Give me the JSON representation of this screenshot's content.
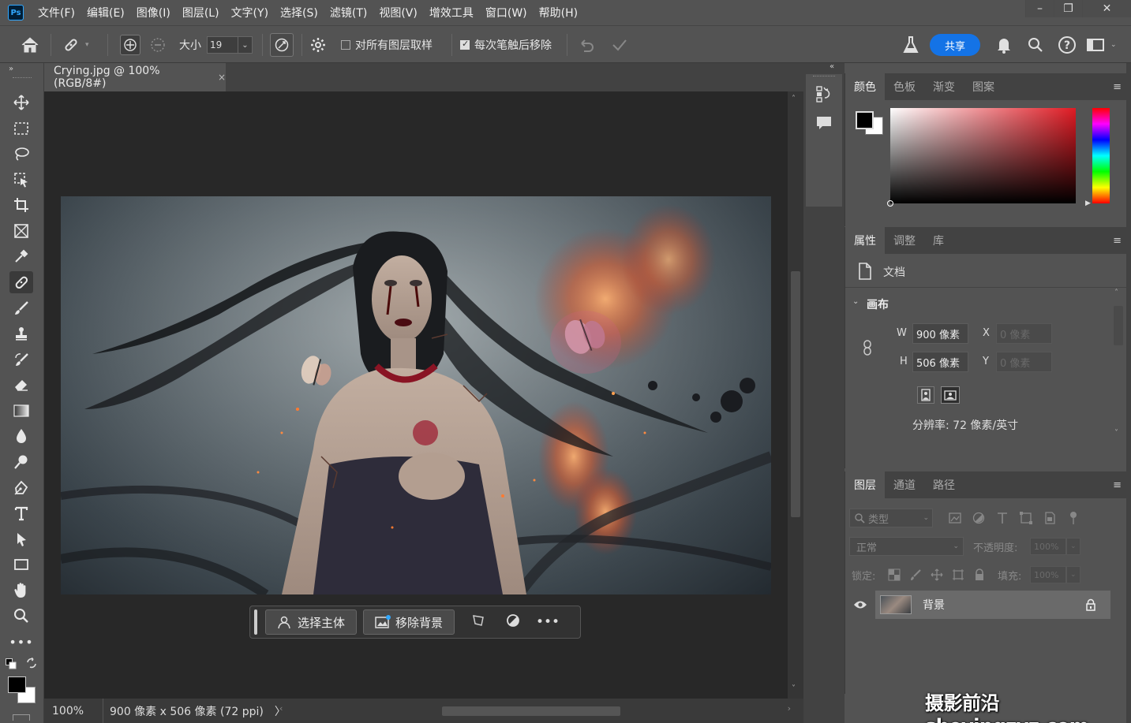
{
  "menubar": {
    "logo": "Ps",
    "items": [
      "文件(F)",
      "编辑(E)",
      "图像(I)",
      "图层(L)",
      "文字(Y)",
      "选择(S)",
      "滤镜(T)",
      "视图(V)",
      "增效工具",
      "窗口(W)",
      "帮助(H)"
    ],
    "window_controls": [
      "–",
      "❐",
      "✕"
    ]
  },
  "options": {
    "size_label": "大小",
    "size_value": "19",
    "sample_all_layers": "对所有图层取样",
    "remove_after_stroke": "每次笔触后移除",
    "share": "共享"
  },
  "document": {
    "tab_title": "Crying.jpg @ 100%(RGB/8#)",
    "tab_close": "×",
    "zoom": "100%",
    "status_info": "900 像素 x 506 像素 (72 ppi)",
    "status_arrow": "〉"
  },
  "context_bar": {
    "select_subject": "选择主体",
    "remove_background": "移除背景",
    "more": "•••"
  },
  "color_panel": {
    "tabs": [
      "颜色",
      "色板",
      "渐变",
      "图案"
    ],
    "foreground": "#000000",
    "background": "#ffffff",
    "hue_color": "#e01b24"
  },
  "properties_panel": {
    "tabs": [
      "属性",
      "调整",
      "库"
    ],
    "doc_label": "文档",
    "canvas_section": "画布",
    "w_label": "W",
    "w_value": "900 像素",
    "h_label": "H",
    "h_value": "506 像素",
    "x_label": "X",
    "x_value": "0 像素",
    "y_label": "Y",
    "y_value": "0 像素",
    "resolution": "分辨率: 72 像素/英寸"
  },
  "layers_panel": {
    "tabs": [
      "图层",
      "通道",
      "路径"
    ],
    "filter_placeholder": "类型",
    "blend_mode": "正常",
    "opacity_label": "不透明度:",
    "opacity_value": "100%",
    "lock_label": "锁定:",
    "fill_label": "填充:",
    "fill_value": "100%",
    "layers": [
      {
        "name": "背景",
        "visible": true,
        "locked": true
      }
    ]
  },
  "watermark": "摄影前沿sheyingzyz.com"
}
